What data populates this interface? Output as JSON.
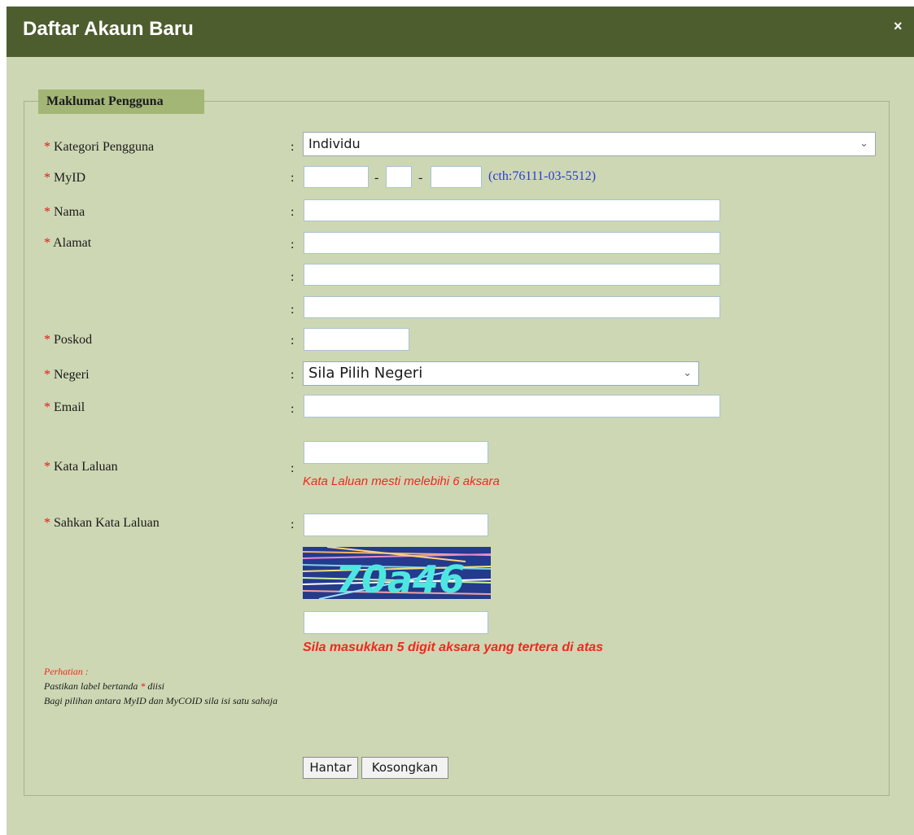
{
  "dialog": {
    "title": "Daftar Akaun Baru",
    "close_label": "×"
  },
  "section": {
    "legend": "Maklumat Pengguna"
  },
  "required_mark": "*",
  "colon": ":",
  "fields": {
    "kategori": {
      "label": "Kategori Pengguna",
      "value": "Individu"
    },
    "myid": {
      "label": "MyID",
      "separator": "-",
      "hint": "(cth:76111-03-5512)"
    },
    "nama": {
      "label": "Nama"
    },
    "alamat": {
      "label": "Alamat"
    },
    "poskod": {
      "label": "Poskod"
    },
    "negeri": {
      "label": "Negeri",
      "value": "Sila Pilih Negeri"
    },
    "email": {
      "label": "Email"
    },
    "kata_laluan": {
      "label": "Kata Laluan",
      "hint": "Kata Laluan mesti melebihi 6 aksara"
    },
    "sahkan": {
      "label": "Sahkan Kata Laluan"
    }
  },
  "captcha": {
    "text": "70a46",
    "instruction": "Sila masukkan 5 digit aksara yang tertera di atas"
  },
  "notes": {
    "heading": "Perhatian :",
    "line1_prefix": "Pastikan label bertanda",
    "line1_suffix": "diisi",
    "line2": "Bagi pilihan antara MyID dan MyCOID sila isi satu sahaja"
  },
  "buttons": {
    "submit": "Hantar",
    "reset": "Kosongkan"
  },
  "colors": {
    "titlebar": "#4e5d2e",
    "background": "#cdd7b3",
    "legend": "#a3b676",
    "error": "#f0281e",
    "hint": "#2b3bd6"
  }
}
